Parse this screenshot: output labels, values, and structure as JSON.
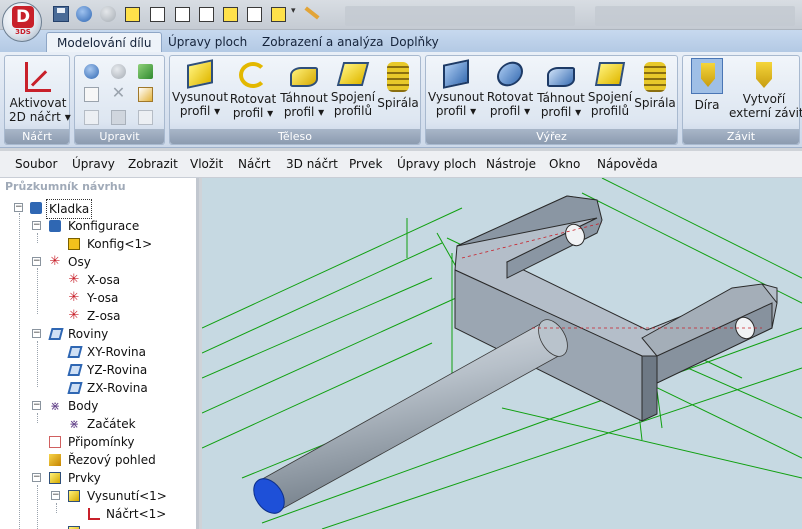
{
  "app": {
    "logo_letter": "D",
    "logo_sub": "3DS"
  },
  "ribbon": {
    "tabs": [
      {
        "label": "Modelování dílu",
        "active": true
      },
      {
        "label": "Úpravy ploch",
        "active": false
      },
      {
        "label": "Zobrazení a analýza",
        "active": false
      },
      {
        "label": "Doplňky",
        "active": false
      }
    ],
    "groups": {
      "nacrt": {
        "label": "Náčrt",
        "buttons": [
          {
            "label1": "Aktivovat",
            "label2": "2D náčrt ▾",
            "icon": "sketch-icon"
          }
        ]
      },
      "upravit": {
        "label": "Upravit"
      },
      "teleso": {
        "label": "Těleso",
        "buttons": [
          {
            "label1": "Vysunout",
            "label2": "profil ▾",
            "icon": "extrude-icon"
          },
          {
            "label1": "Rotovat",
            "label2": "profil ▾",
            "icon": "revolve-icon"
          },
          {
            "label1": "Táhnout",
            "label2": "profil ▾",
            "icon": "sweep-icon"
          },
          {
            "label1": "Spojení",
            "label2": "profilů",
            "icon": "loft-icon"
          },
          {
            "label1": "Spirála",
            "label2": "",
            "icon": "spiral-icon"
          }
        ]
      },
      "vyrez": {
        "label": "Výřez",
        "buttons": [
          {
            "label1": "Vysunout",
            "label2": "profil ▾",
            "icon": "extrude-cut-icon"
          },
          {
            "label1": "Rotovat",
            "label2": "profil ▾",
            "icon": "revolve-cut-icon"
          },
          {
            "label1": "Táhnout",
            "label2": "profil ▾",
            "icon": "sweep-cut-icon"
          },
          {
            "label1": "Spojení",
            "label2": "profilů",
            "icon": "loft-cut-icon"
          },
          {
            "label1": "Spirála",
            "label2": "",
            "icon": "spiral-cut-icon"
          }
        ]
      },
      "zavit": {
        "label": "Závit",
        "buttons": [
          {
            "label1": "Díra",
            "label2": "",
            "icon": "hole-icon"
          },
          {
            "label1": "Vytvoří",
            "label2": "externí závit",
            "icon": "thread-icon"
          }
        ]
      }
    }
  },
  "menu": {
    "items": [
      "Soubor",
      "Úpravy",
      "Zobrazit",
      "Vložit",
      "Náčrt",
      "3D náčrt",
      "Prvek",
      "Úpravy ploch",
      "Nástroje",
      "Okno",
      "Nápověda"
    ]
  },
  "tree": {
    "header": "Průzkumník návrhu",
    "rows": [
      {
        "label": "Kladka"
      },
      {
        "label": "Konfigurace"
      },
      {
        "label": "Konfig<1>"
      },
      {
        "label": "Osy"
      },
      {
        "label": "X-osa"
      },
      {
        "label": "Y-osa"
      },
      {
        "label": "Z-osa"
      },
      {
        "label": "Roviny"
      },
      {
        "label": "XY-Rovina"
      },
      {
        "label": "YZ-Rovina"
      },
      {
        "label": "ZX-Rovina"
      },
      {
        "label": "Body"
      },
      {
        "label": "Začátek"
      },
      {
        "label": "Připomínky"
      },
      {
        "label": "Řezový pohled"
      },
      {
        "label": "Prvky"
      },
      {
        "label": "Vysunutí<1>"
      },
      {
        "label": "Náčrt<1>"
      }
    ]
  },
  "colors": {
    "ribbon_accent": "#b3c9e4",
    "viewport_bg": "#c6d9e2",
    "construction_lines": "#10a010",
    "model_face": "#a4aeb8",
    "end_face": "#1e50d8"
  }
}
